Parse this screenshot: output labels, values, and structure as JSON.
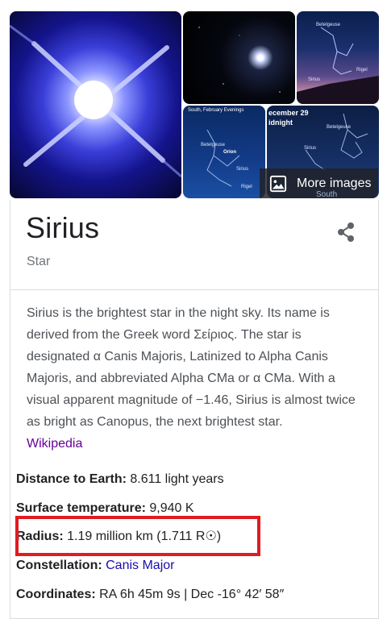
{
  "gallery": {
    "tiles": {
      "main": {
        "icon": "sirius-star-photo"
      },
      "a": {
        "icon": "night-sky-star-photo"
      },
      "b": {
        "label_1": "Betelgeuse",
        "label_2": "Sirius",
        "label_3": "Rigel"
      },
      "c": {
        "header": "South, February Evenings",
        "label_1": "Betelgeuse",
        "label_2": "Orion",
        "label_3": "Sirius",
        "label_4": "Rigel"
      },
      "d": {
        "header_1": "ecember 29",
        "header_2": "idnight",
        "label_1": "Betelgeuse",
        "label_2": "Sirius"
      }
    },
    "more_images_label": "More images",
    "south_label": "South"
  },
  "entity": {
    "title": "Sirius",
    "subtitle": "Star"
  },
  "description": {
    "text": "Sirius is the brightest star in the night sky. Its name is derived from the Greek word Σείριος. The star is designated α Canis Majoris, Latinized to Alpha Canis Majoris, and abbreviated Alpha CMa or α CMa. With a visual apparent magnitude of −1.46, Sirius is almost twice as bright as Canopus, the next brightest star.",
    "source_link": "Wikipedia"
  },
  "facts": [
    {
      "label": "Distance to Earth:",
      "value": "8.611 light years"
    },
    {
      "label": "Surface temperature:",
      "value": "9,940 K"
    },
    {
      "label": "Radius:",
      "value": "1.19 million km (1.711 R☉)"
    },
    {
      "label": "Constellation:",
      "value": "Canis Major"
    },
    {
      "label": "Coordinates:",
      "value": "RA 6h 45m 9s | Dec -16° 42′ 58″"
    }
  ],
  "colors": {
    "highlight_border": "#e11b22",
    "link": "#1a0dab",
    "visited_link": "#660099"
  }
}
